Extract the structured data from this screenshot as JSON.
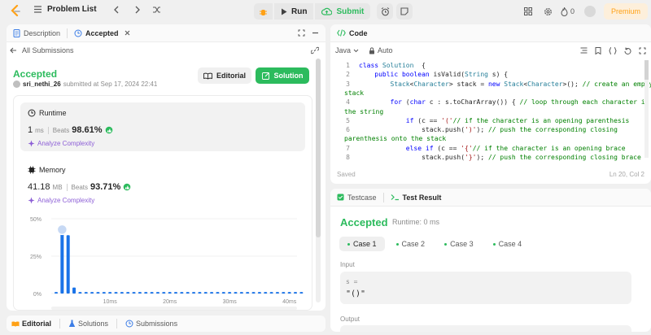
{
  "topnav": {
    "problem_list": "Problem List",
    "run": "Run",
    "submit": "Submit",
    "fire_count": "0",
    "premium": "Premium"
  },
  "left": {
    "tabs": [
      {
        "label": "Description",
        "icon": "document-icon"
      },
      {
        "label": "Accepted",
        "icon": "history-icon",
        "active": true
      }
    ],
    "back_link": "All Submissions",
    "status": "Accepted",
    "user": "sri_nethi_26",
    "submitted_text": "submitted at Sep 17, 2024 22:41",
    "editorial_button": "Editorial",
    "solution_button": "Solution",
    "runtime": {
      "label": "Runtime",
      "value": "1",
      "unit": "ms",
      "beats_label": "Beats",
      "beats_value": "98.61%",
      "analyze": "Analyze Complexity"
    },
    "memory": {
      "label": "Memory",
      "value": "41.18",
      "unit": "MB",
      "beats_label": "Beats",
      "beats_value": "93.71%",
      "analyze": "Analyze Complexity"
    },
    "bottom_tabs": [
      "Editorial",
      "Solutions",
      "Submissions"
    ]
  },
  "chart_data": {
    "type": "bar",
    "x": [
      1,
      2,
      3,
      4,
      5,
      6,
      7,
      8,
      9,
      10,
      11,
      12,
      13,
      14,
      15,
      16,
      17,
      18,
      19,
      20,
      21,
      22,
      23,
      24,
      25,
      26,
      27,
      28,
      29,
      30,
      31,
      32,
      33,
      34,
      35,
      36,
      37,
      38,
      39,
      40,
      41,
      42
    ],
    "values": [
      1,
      46,
      39,
      4,
      1,
      1,
      1,
      1,
      1,
      1,
      1,
      1,
      1,
      1,
      1,
      1,
      1,
      1,
      1,
      1,
      1,
      1,
      1,
      1,
      1,
      1,
      1,
      1,
      1,
      1,
      1,
      1,
      1,
      1,
      1,
      1,
      1,
      1,
      1,
      1,
      1,
      1
    ],
    "highlight_index": 1,
    "ylim": [
      0,
      50
    ],
    "yticks": [
      "50%",
      "25%",
      "0%"
    ],
    "xticks": [
      "10ms",
      "20ms",
      "30ms",
      "40ms"
    ],
    "xtick_values": [
      10,
      20,
      30,
      40
    ],
    "colors": {
      "bar": "#1a73e8",
      "highlight": "#c7d9f4"
    }
  },
  "code": {
    "tab_label": "Code",
    "language": "Java",
    "auto_label": "Auto",
    "saved": "Saved",
    "cursor": "Ln 20, Col 2",
    "lines": [
      {
        "n": "1",
        "parts": [
          [
            "kw",
            "class "
          ],
          [
            "ty",
            "Solution"
          ],
          [
            "",
            "  {"
          ]
        ]
      },
      {
        "n": "2",
        "parts": [
          [
            "",
            "    "
          ],
          [
            "kw",
            "public boolean "
          ],
          [
            "",
            "isValid("
          ],
          [
            "ty",
            "String"
          ],
          [
            "",
            " s) {"
          ]
        ]
      },
      {
        "n": "3",
        "parts": [
          [
            "",
            "        "
          ],
          [
            "ty",
            "Stack"
          ],
          [
            "",
            "<"
          ],
          [
            "ty",
            "Character"
          ],
          [
            "",
            "> stack = "
          ],
          [
            "kw",
            "new "
          ],
          [
            "ty",
            "Stack"
          ],
          [
            "",
            "<"
          ],
          [
            "ty",
            "Character"
          ],
          [
            "",
            ">(); "
          ],
          [
            "cm",
            "// create an empty"
          ]
        ]
      },
      {
        "n": "",
        "parts": [
          [
            "cm",
            "stack"
          ]
        ],
        "wrap": true
      },
      {
        "n": "4",
        "parts": [
          [
            "",
            "        "
          ],
          [
            "kw",
            "for "
          ],
          [
            "",
            "("
          ],
          [
            "kw",
            "char "
          ],
          [
            "",
            "c : s.toCharArray()) { "
          ],
          [
            "cm",
            "// loop through each character in"
          ]
        ]
      },
      {
        "n": "",
        "parts": [
          [
            "cm",
            "the string"
          ]
        ],
        "wrap": true
      },
      {
        "n": "5",
        "parts": [
          [
            "",
            "            "
          ],
          [
            "kw",
            "if "
          ],
          [
            "",
            "(c == "
          ],
          [
            "st",
            "'('"
          ],
          [
            ") "
          ],
          [
            "cm",
            "// if the character is an opening parenthesis"
          ]
        ]
      },
      {
        "n": "6",
        "parts": [
          [
            "",
            "                stack.push("
          ],
          [
            "st",
            "')'"
          ],
          [
            "",
            "); "
          ],
          [
            "cm",
            "// push the corresponding closing"
          ]
        ]
      },
      {
        "n": "",
        "parts": [
          [
            "cm",
            "parenthesis onto the stack"
          ]
        ],
        "wrap": true
      },
      {
        "n": "7",
        "parts": [
          [
            "",
            "            "
          ],
          [
            "kw",
            "else if "
          ],
          [
            "",
            "(c == "
          ],
          [
            "st",
            "'{'"
          ],
          [
            ") "
          ],
          [
            "cm",
            "// if the character is an opening brace"
          ]
        ]
      },
      {
        "n": "8",
        "parts": [
          [
            "",
            "                stack.push("
          ],
          [
            "st",
            "'}'"
          ],
          [
            "",
            "); "
          ],
          [
            "cm",
            "// push the corresponding closing brace"
          ]
        ]
      }
    ]
  },
  "result": {
    "tabs": [
      "Testcase",
      "Test Result"
    ],
    "status": "Accepted",
    "runtime": "Runtime: 0 ms",
    "cases": [
      "Case 1",
      "Case 2",
      "Case 3",
      "Case 4"
    ],
    "input_label": "Input",
    "input_var": "s =",
    "input_value": "\"()\"",
    "output_label": "Output"
  },
  "colors": {
    "accent_green": "#2cbb5d",
    "premium_orange": "#ffa116",
    "analyze_purple": "#8c5ed6"
  }
}
